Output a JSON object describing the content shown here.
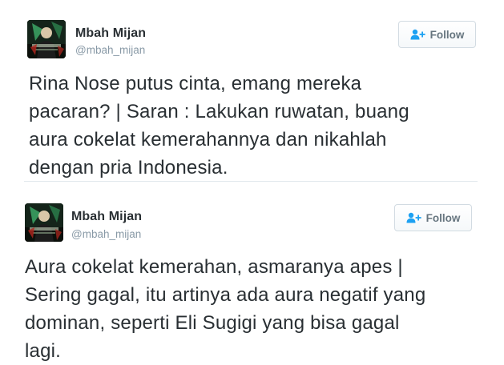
{
  "tweets": [
    {
      "display_name": "Mbah Mijan",
      "handle": "@mbah_mijan",
      "follow_label": "Follow",
      "text_lines": [
        "Rina Nose putus cinta, emang mereka",
        "pacaran? | Saran : Lakukan ruwatan, buang",
        "aura cokelat kemerahannya dan nikahlah",
        "dengan pria Indonesia."
      ]
    },
    {
      "display_name": "Mbah Mijan",
      "handle": "@mbah_mijan",
      "follow_label": "Follow",
      "text_lines": [
        "Aura cokelat kemerahan, asmaranya apes |",
        "Sering gagal, itu artinya ada aura negatif yang",
        "dominan, seperti Eli Sugigi yang bisa gagal",
        "lagi."
      ]
    }
  ],
  "colors": {
    "text": "#292f33",
    "handle": "#8899a6",
    "button_text": "#66757f",
    "button_border": "#d2dbe2",
    "divider": "#e1e8ed",
    "follow_icon": "#1da1f2"
  },
  "icons": {
    "follow": "person-plus-icon"
  }
}
